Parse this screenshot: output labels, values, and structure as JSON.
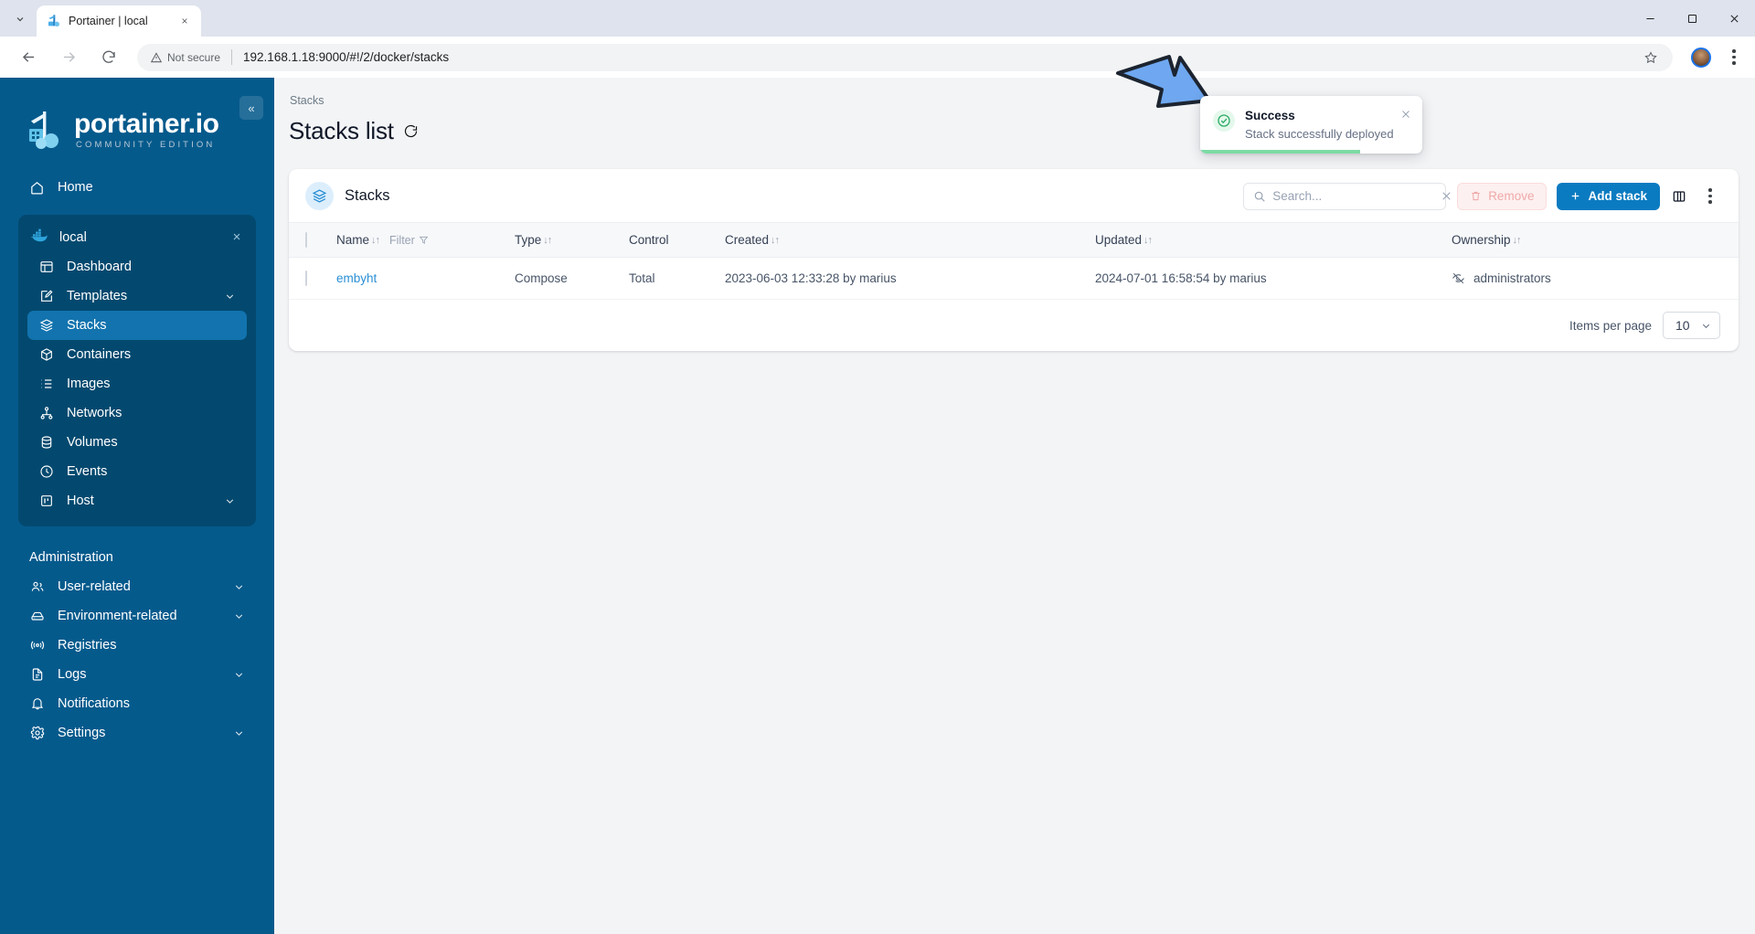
{
  "browser": {
    "tab": {
      "title": "Portainer | local",
      "favicon": "portainer-favicon-icon",
      "close": "×"
    },
    "tab_list_icon": "chevron-down-icon",
    "window_controls": {
      "minimize": "—",
      "maximize": "▢",
      "close": "✕"
    },
    "back": "←",
    "forward": "→",
    "reload": "⟳",
    "security_label": "Not secure",
    "url": "192.168.1.18:9000/#!/2/docker/stacks",
    "bookmark_icon": "star-icon",
    "profile_icon": "avatar",
    "menu_icon": "kebab-menu-icon"
  },
  "sidebar": {
    "collapse_label": "«",
    "logo": {
      "main": "portainer.io",
      "sub": "COMMUNITY EDITION"
    },
    "home": {
      "label": "Home",
      "icon": "home-icon"
    },
    "environment": {
      "name": "local",
      "icon": "docker-icon",
      "close": "×",
      "items": [
        {
          "label": "Dashboard",
          "icon": "dashboard-icon",
          "active": false,
          "expandable": false
        },
        {
          "label": "Templates",
          "icon": "templates-icon",
          "active": false,
          "expandable": true
        },
        {
          "label": "Stacks",
          "icon": "stacks-icon",
          "active": true,
          "expandable": false
        },
        {
          "label": "Containers",
          "icon": "containers-icon",
          "active": false,
          "expandable": false
        },
        {
          "label": "Images",
          "icon": "images-icon",
          "active": false,
          "expandable": false
        },
        {
          "label": "Networks",
          "icon": "networks-icon",
          "active": false,
          "expandable": false
        },
        {
          "label": "Volumes",
          "icon": "volumes-icon",
          "active": false,
          "expandable": false
        },
        {
          "label": "Events",
          "icon": "events-icon",
          "active": false,
          "expandable": false
        },
        {
          "label": "Host",
          "icon": "host-icon",
          "active": false,
          "expandable": true
        }
      ]
    },
    "admin_section_title": "Administration",
    "admin_items": [
      {
        "label": "User-related",
        "icon": "users-icon",
        "expandable": true
      },
      {
        "label": "Environment-related",
        "icon": "environment-icon",
        "expandable": true
      },
      {
        "label": "Registries",
        "icon": "registries-icon",
        "expandable": false
      },
      {
        "label": "Logs",
        "icon": "logs-icon",
        "expandable": true
      },
      {
        "label": "Notifications",
        "icon": "bell-icon",
        "expandable": false
      },
      {
        "label": "Settings",
        "icon": "gear-icon",
        "expandable": true
      }
    ]
  },
  "main": {
    "breadcrumb": "Stacks",
    "title": "Stacks list",
    "refresh_icon": "refresh-icon",
    "card": {
      "icon": "stacks-icon",
      "title": "Stacks",
      "search_placeholder": "Search...",
      "search_value": "",
      "search_clear": "×",
      "remove_label": "Remove",
      "remove_icon": "trash-icon",
      "add_stack_label": "Add stack",
      "add_stack_icon": "plus-icon",
      "columns_icon": "columns-layout-icon",
      "more_icon": "kebab-menu-icon"
    },
    "table": {
      "columns": [
        {
          "label": "Name",
          "sortable": true,
          "filter": "Filter",
          "filter_icon": "funnel-icon"
        },
        {
          "label": "Type",
          "sortable": true
        },
        {
          "label": "Control",
          "sortable": false
        },
        {
          "label": "Created",
          "sortable": true
        },
        {
          "label": "Updated",
          "sortable": true
        },
        {
          "label": "Ownership",
          "sortable": true
        }
      ],
      "sort_glyph": "↓↑",
      "rows": [
        {
          "name": "embyht",
          "type": "Compose",
          "control": "Total",
          "created": "2023-06-03 12:33:28 by marius",
          "updated": "2024-07-01 16:58:54 by marius",
          "ownership": "administrators",
          "ownership_icon": "eye-off-icon"
        }
      ]
    },
    "footer": {
      "items_per_page_label": "Items per page",
      "items_per_page_value": "10",
      "chevron": "chevron-down-icon"
    }
  },
  "toast": {
    "icon": "check-circle-icon",
    "title": "Success",
    "message": "Stack successfully deployed",
    "close": "×"
  },
  "annotation": {
    "arrow": "blue-arrow-pointing-down-right"
  },
  "colors": {
    "sidebar_bg": "#055a8c",
    "sidebar_env_bg": "#03496f",
    "sidebar_active": "#1273ae",
    "accent_blue": "#0b7bc1",
    "link_blue": "#2a8fd4",
    "page_bg": "#f3f4f6",
    "success_green": "#2eac66",
    "arrow_blue": "#6fa8f0"
  }
}
